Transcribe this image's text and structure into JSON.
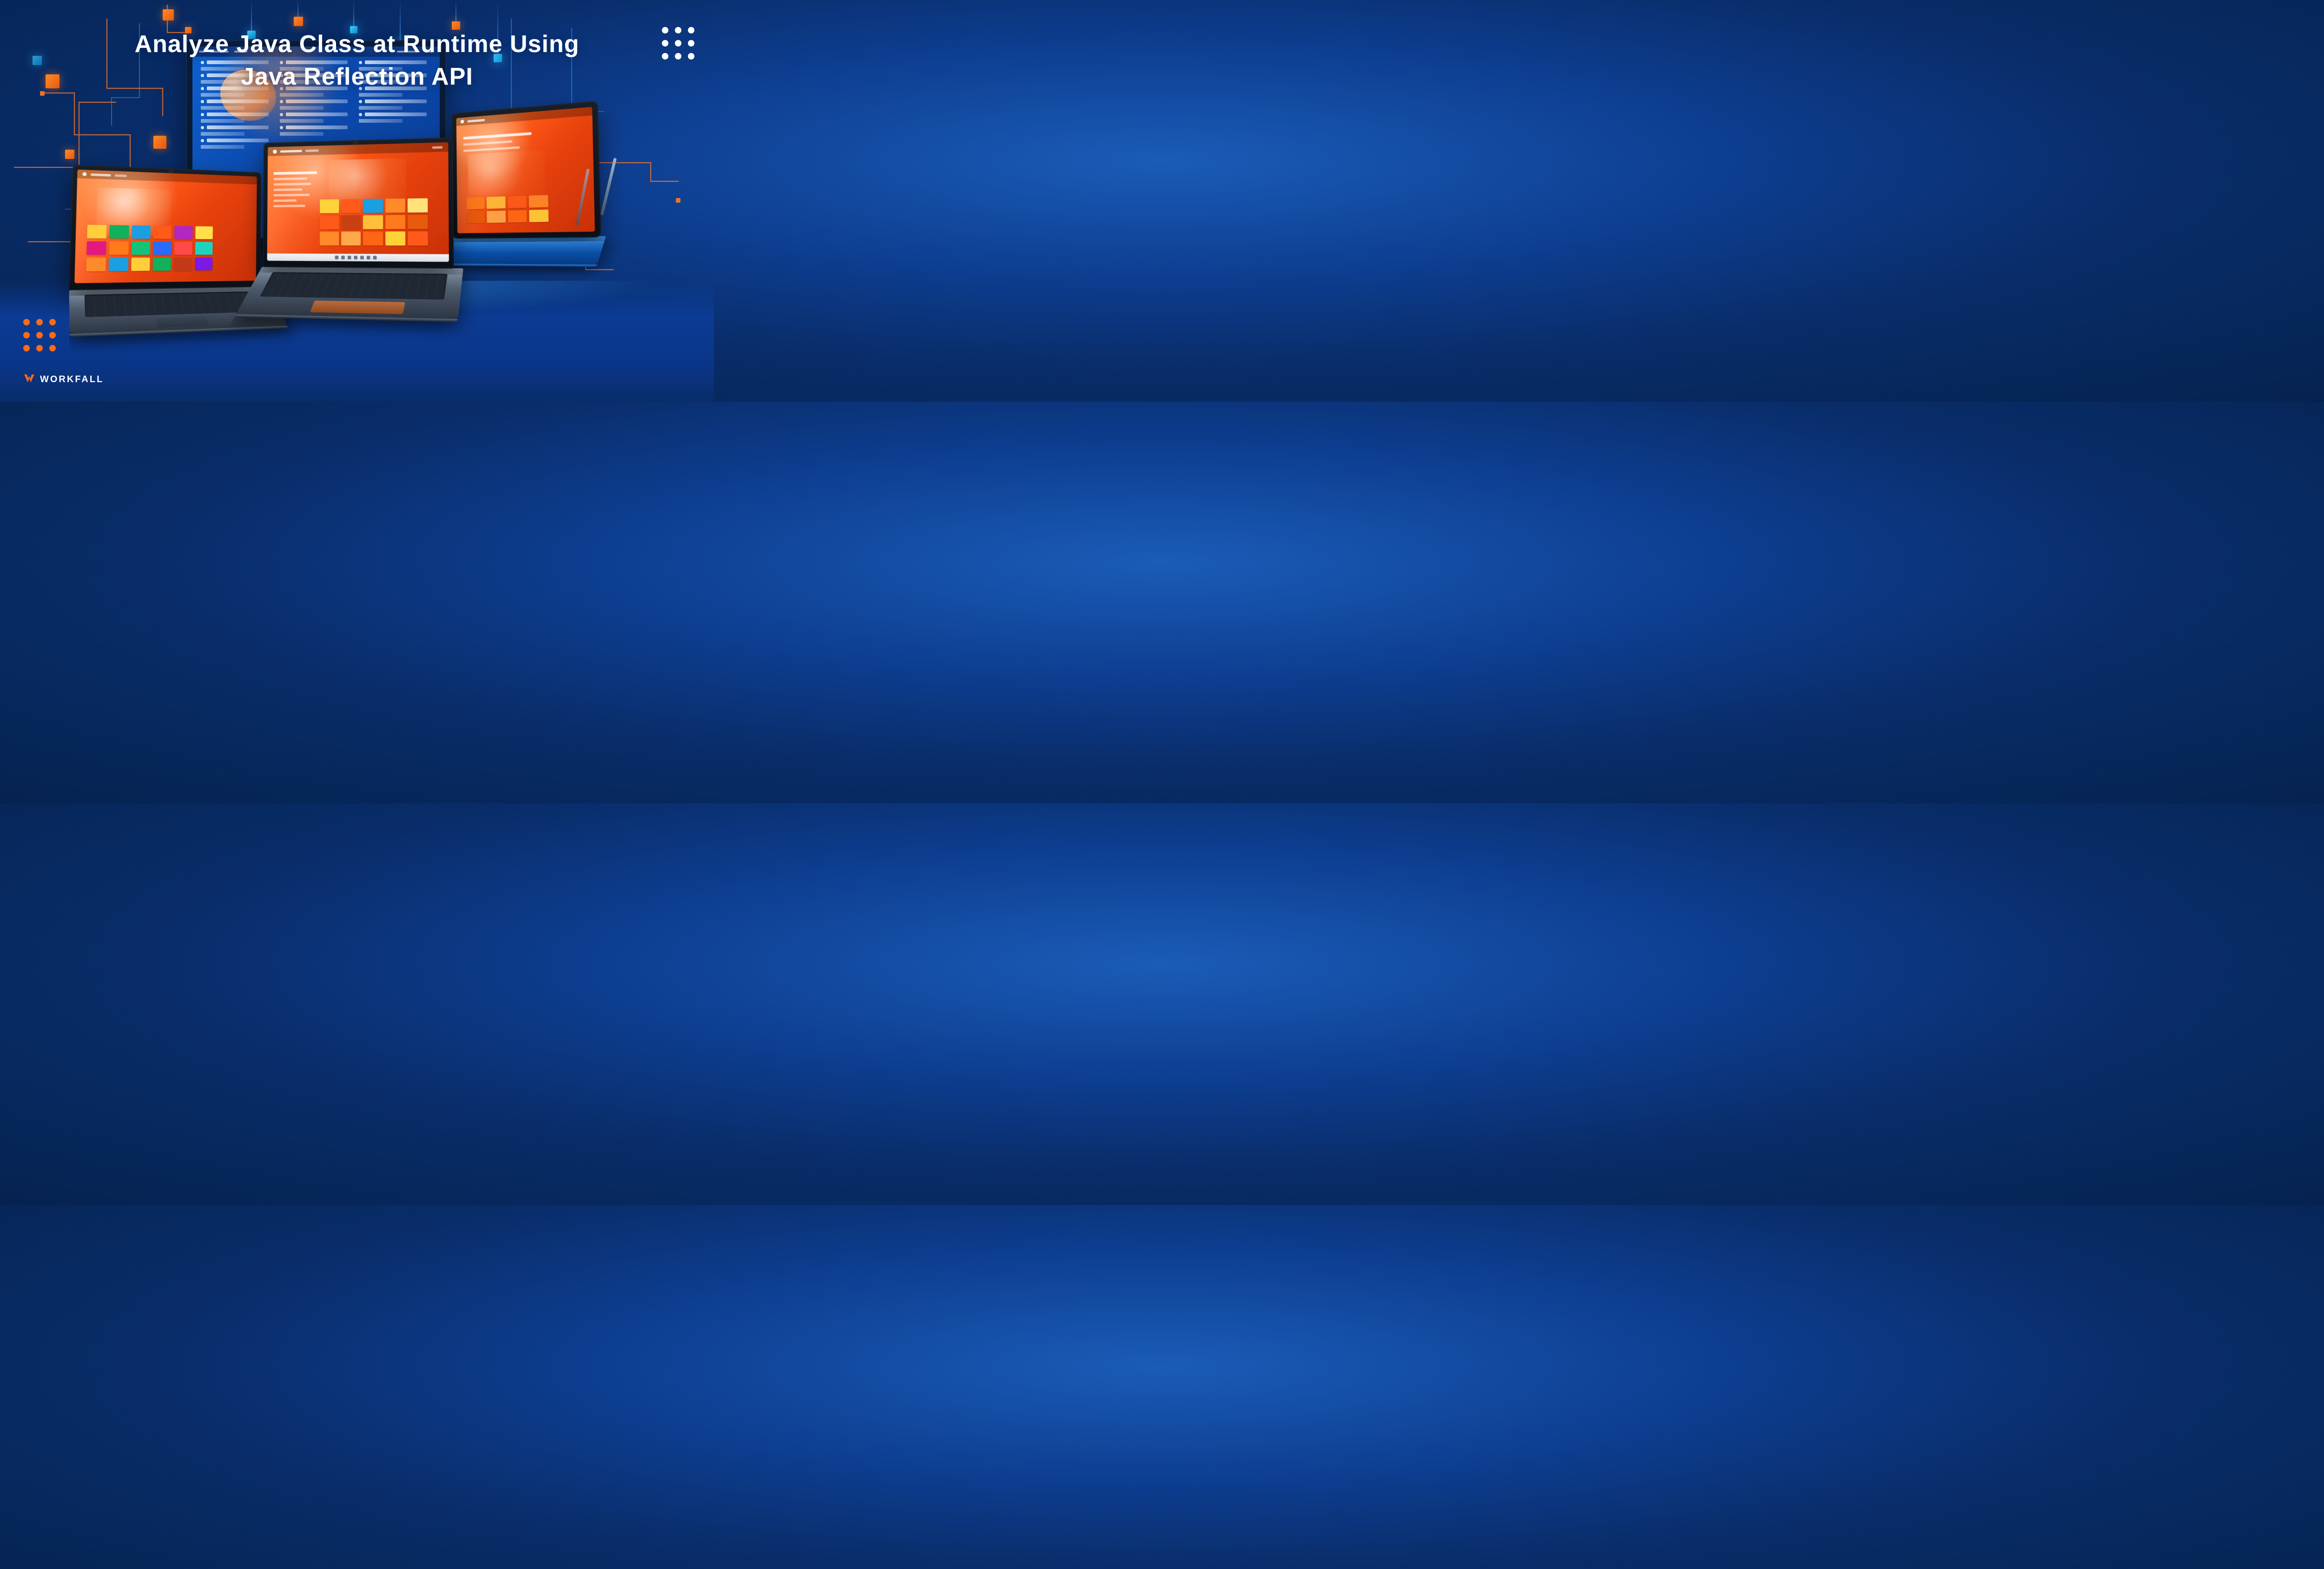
{
  "title": {
    "line1": "Analyze Java Class at Runtime Using",
    "line2": "Java Reflection API"
  },
  "brand": {
    "name": "WORKFALL"
  },
  "colors": {
    "orange": "#ff6a1a",
    "cyan": "#1fb8ff",
    "bg_deep": "#05224f"
  }
}
